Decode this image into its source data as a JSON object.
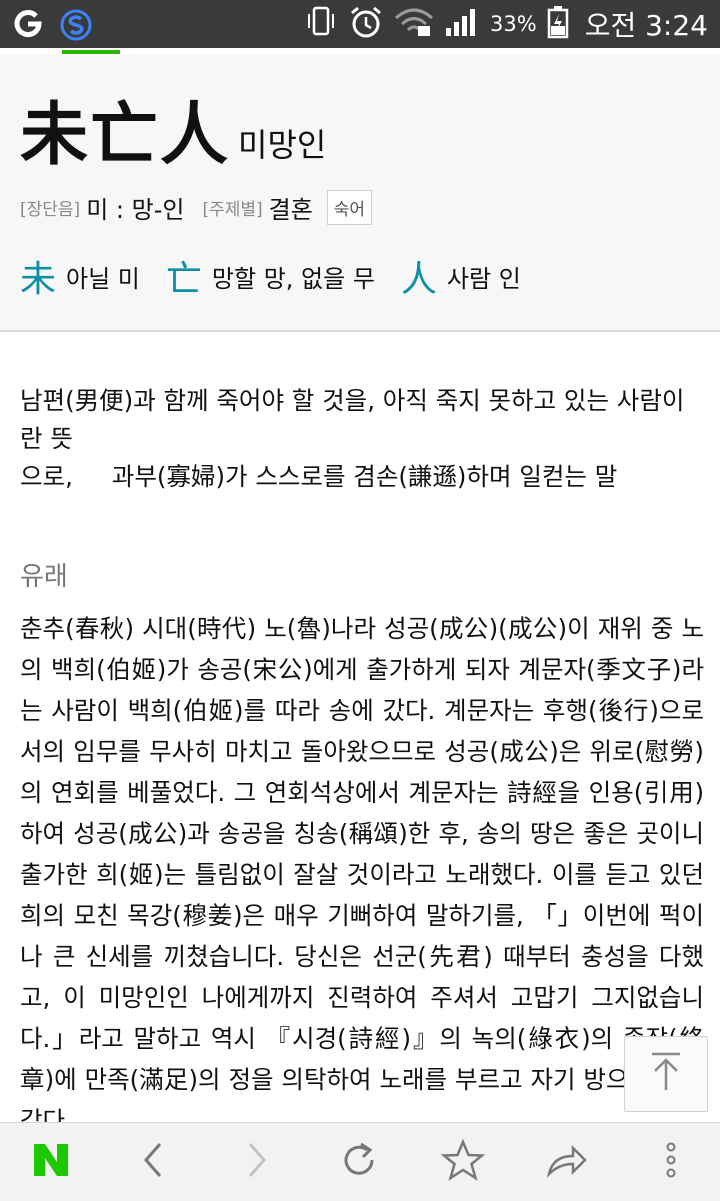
{
  "status_bar": {
    "battery_percent": "33%",
    "clock": "오전 3:24",
    "icons": [
      "g-app-icon",
      "s-app-icon",
      "vibrate-icon",
      "alarm-icon",
      "wifi-icon",
      "signal-icon",
      "battery-icon"
    ]
  },
  "entry": {
    "idiom_hanja": "未亡人",
    "reading": "미망인",
    "pronunciation_tag": "[장단음]",
    "pronunciation_value": "미 : 망-인",
    "topic_tag": "[주제별]",
    "topic_value": "결혼",
    "type_badge": "숙어",
    "characters": [
      {
        "hanja": "未",
        "meaning": "아닐 미"
      },
      {
        "hanja": "亡",
        "meaning": "망할 망, 없을 무"
      },
      {
        "hanja": "人",
        "meaning": "사람 인"
      }
    ]
  },
  "definition": {
    "line1": "남편(男便)과 함께 죽어야 할 것을, 아직 죽지 못하고 있는 사람이란 뜻",
    "line2": "으로,     과부(寡婦)가 스스로를 겸손(謙遜)하며 일컫는 말"
  },
  "origin": {
    "heading": "유래",
    "text": "춘추(春秋) 시대(時代) 노(魯)나라 성공(成公)(成公)이 재위 중 노의 백희(伯姬)가 송공(宋公)에게 출가하게 되자 계문자(季文子)라는 사람이 백희(伯姬)를 따라 송에 갔다. 계문자는 후행(後行)으로서의 임무를 무사히 마치고 돌아왔으므로 성공(成公)은 위로(慰勞)의 연회를 베풀었다. 그 연회석상에서 계문자는 詩經을 인용(引用)하여 성공(成公)과 송공을 칭송(稱頌)한 후, 송의 땅은 좋은 곳이니 출가한 희(姬)는 틀림없이 잘살 것이라고 노래했다. 이를 듣고 있던 희의 모친 목강(穆姜)은 매우 기뻐하여 말하기를, 「」이번에 퍽이나 큰 신세를 끼쳤습니다. 당신은 선군(先君) 때부터 충성을 다했고, 이 미망인인 나에게까지 진력하여 주셔서 고맙기 그지없습니다.」라고 말하고 역시 『시경(詩經)』의 녹의(綠衣)의 종장(終章)에 만족(滿足)의 정을 의탁하여 노래를 부르고 자기 방으로 돌아갔다."
  },
  "toolbar": {
    "logo": "N",
    "icons": [
      "naver-logo-icon",
      "back-icon",
      "forward-icon",
      "refresh-icon",
      "bookmark-star-icon",
      "share-icon",
      "more-icon"
    ]
  },
  "colors": {
    "status_bar_bg": "#3a3a3a",
    "accent_green": "#2db400",
    "hanja_blue": "#0d8fa6",
    "header_bg": "#f7f7f7",
    "toolbar_bg": "#f2f2f2"
  }
}
